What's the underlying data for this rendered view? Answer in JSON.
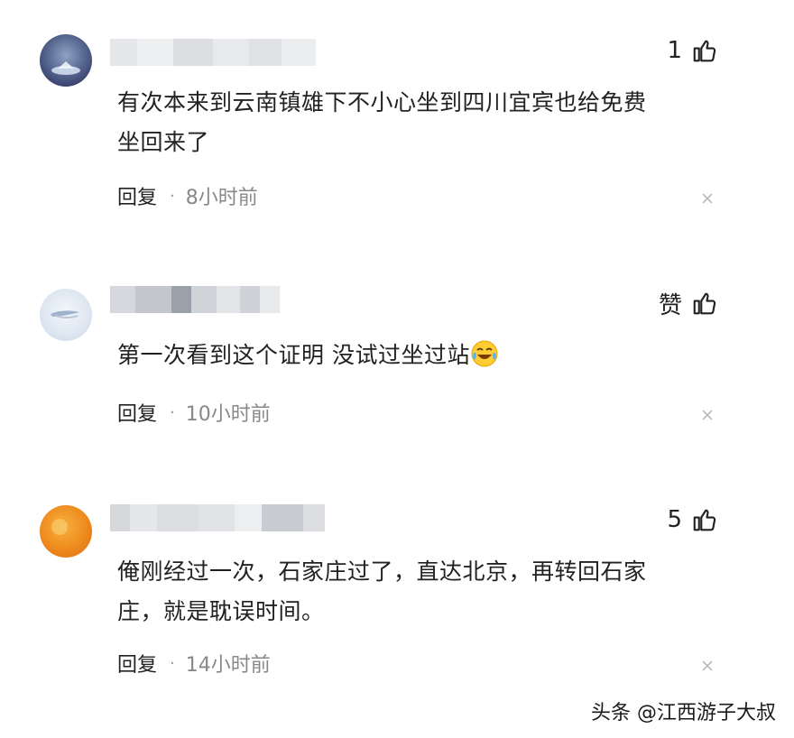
{
  "comments": [
    {
      "avatar": "user-avatar-1",
      "likes": "1",
      "text": "有次本来到云南镇雄下不小心坐到四川宜宾也给免费\n坐回来了",
      "reply_label": "回复",
      "separator": "·",
      "time": "8小时前"
    },
    {
      "avatar": "user-avatar-2",
      "likes": "赞",
      "text": "第一次看到这个证明 没试过坐过站",
      "emoji": "laughing-crying-emoji",
      "reply_label": "回复",
      "separator": "·",
      "time": "10小时前"
    },
    {
      "avatar": "user-avatar-3",
      "likes": "5",
      "text": "俺刚经过一次，石家庄过了，直达北京，再转回石家\n庄，就是耽误时间。",
      "reply_label": "回复",
      "separator": "·",
      "time": "14小时前"
    }
  ],
  "watermark": "头条 @江西游子大叔",
  "icons": {
    "like": "thumbs-up-icon",
    "close": "close-icon"
  },
  "colors": {
    "text": "#222222",
    "muted": "#888888",
    "close": "#bbbbbb"
  }
}
